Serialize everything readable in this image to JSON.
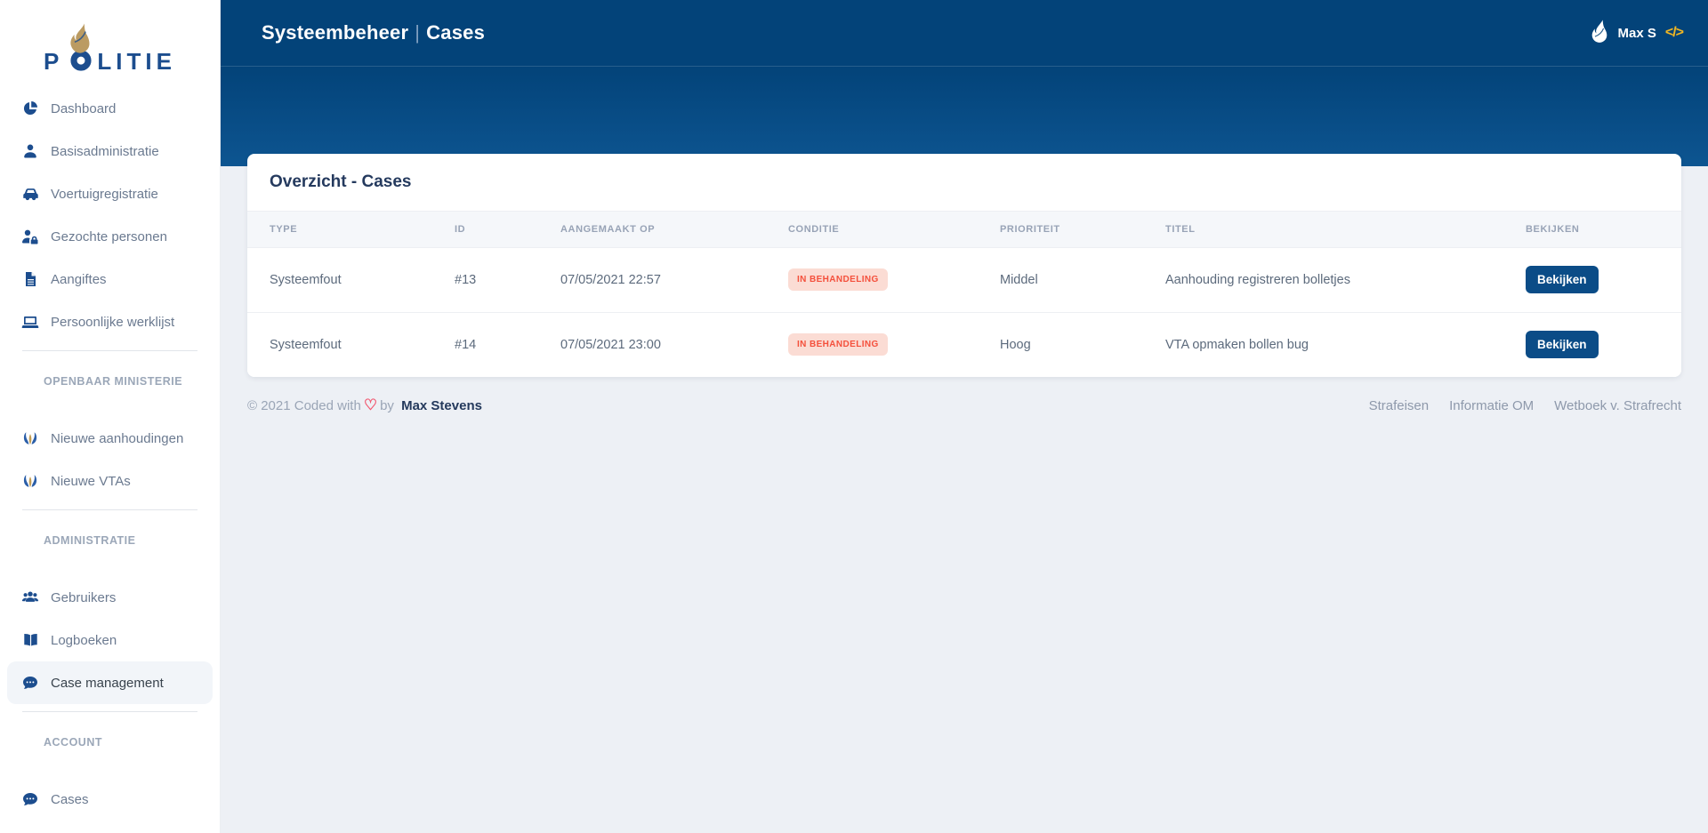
{
  "sidebar": {
    "logo": {
      "first_letter": "P",
      "rest_letters": "LITIE"
    },
    "sections": [
      {
        "heading": "",
        "items": [
          {
            "label": "Dashboard"
          },
          {
            "label": "Basisadministratie"
          },
          {
            "label": "Voertuigregistratie"
          },
          {
            "label": "Gezochte personen"
          },
          {
            "label": "Aangiftes"
          },
          {
            "label": "Persoonlijke werklijst"
          }
        ]
      },
      {
        "heading": "OPENBAAR MINISTERIE",
        "items": [
          {
            "label": "Nieuwe aanhoudingen"
          },
          {
            "label": "Nieuwe VTAs"
          }
        ]
      },
      {
        "heading": "ADMINISTRATIE",
        "items": [
          {
            "label": "Gebruikers"
          },
          {
            "label": "Logboeken"
          },
          {
            "label": "Case management"
          }
        ]
      },
      {
        "heading": "ACCOUNT",
        "items": [
          {
            "label": "Cases"
          }
        ]
      }
    ]
  },
  "header": {
    "title": "Systeembeheer",
    "separator": "|",
    "subtitle": "Cases",
    "username": "Max S",
    "code_icon": {
      "open": "</",
      "close": ">"
    }
  },
  "card": {
    "title": "Overzicht - Cases"
  },
  "table": {
    "columns": [
      "TYPE",
      "ID",
      "AANGEMAAKT OP",
      "CONDITIE",
      "PRIORITEIT",
      "TITEL",
      "BEKIJKEN"
    ],
    "rows": [
      {
        "type": "Systeemfout",
        "id": "#13",
        "created_at": "07/05/2021 22:57",
        "condition": "IN BEHANDELING",
        "priority": "Middel",
        "title": "Aanhouding registreren bolletjes",
        "action": "Bekijken"
      },
      {
        "type": "Systeemfout",
        "id": "#14",
        "created_at": "07/05/2021 23:00",
        "condition": "IN BEHANDELING",
        "priority": "Hoog",
        "title": "VTA opmaken bollen bug",
        "action": "Bekijken"
      }
    ]
  },
  "footer": {
    "copyright": "© 2021 Coded with",
    "heart": "♡",
    "by": "by",
    "author": "Max Stevens",
    "links": [
      {
        "label": "Strafeisen"
      },
      {
        "label": "Informatie OM"
      },
      {
        "label": "Wetboek v. Strafrecht"
      }
    ]
  },
  "colors": {
    "brand_blue": "#0b4c87",
    "header_blue_top": "#034379",
    "header_blue_bottom": "#0d5591",
    "politie_gold": "#bb9b62",
    "badge_bg": "#fbdcd4",
    "badge_text": "#f4503c"
  }
}
